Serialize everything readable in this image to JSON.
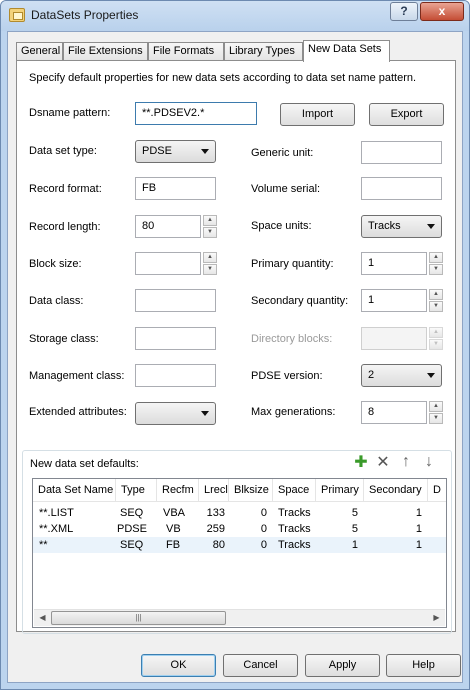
{
  "window": {
    "title": "DataSets Properties",
    "help_glyph": "?",
    "close_glyph": "x"
  },
  "tabs": [
    "General",
    "File Extensions",
    "File Formats",
    "Library Types",
    "New Data Sets"
  ],
  "active_tab": "New Data Sets",
  "description": "Specify default properties for new data sets according to data set name pattern.",
  "dsname": {
    "label": "Dsname pattern:",
    "value": "**.PDSEV2.*"
  },
  "buttons": {
    "import": "Import",
    "export": "Export"
  },
  "left_fields": {
    "data_set_type": {
      "label": "Data set type:",
      "value": "PDSE"
    },
    "record_format": {
      "label": "Record format:",
      "value": "FB"
    },
    "record_length": {
      "label": "Record length:",
      "value": "80"
    },
    "block_size": {
      "label": "Block size:",
      "value": ""
    },
    "data_class": {
      "label": "Data class:",
      "value": ""
    },
    "storage_class": {
      "label": "Storage class:",
      "value": ""
    },
    "management_class": {
      "label": "Management class:",
      "value": ""
    },
    "extended_attributes": {
      "label": "Extended attributes:",
      "value": ""
    }
  },
  "right_fields": {
    "generic_unit": {
      "label": "Generic unit:",
      "value": ""
    },
    "volume_serial": {
      "label": "Volume serial:",
      "value": ""
    },
    "space_units": {
      "label": "Space units:",
      "value": "Tracks"
    },
    "primary_quantity": {
      "label": "Primary quantity:",
      "value": "1"
    },
    "secondary_quantity": {
      "label": "Secondary quantity:",
      "value": "1"
    },
    "directory_blocks": {
      "label": "Directory blocks:",
      "value": ""
    },
    "pdse_version": {
      "label": "PDSE version:",
      "value": "2"
    },
    "max_generations": {
      "label": "Max generations:",
      "value": "8"
    }
  },
  "defaults": {
    "label": "New data set defaults:",
    "toolbar_icons": [
      "add-icon",
      "delete-icon",
      "move-up-icon",
      "move-down-icon"
    ],
    "columns": [
      "Data Set Name",
      "Type",
      "Recfm",
      "Lrecl",
      "Blksize",
      "Space",
      "Primary",
      "Secondary",
      "D"
    ],
    "rows": [
      [
        "**.LIST",
        "SEQ",
        "VBA",
        "133",
        "0",
        "Tracks",
        "5",
        "1"
      ],
      [
        "**.XML",
        "PDSE",
        "VB",
        "259",
        "0",
        "Tracks",
        "5",
        "1"
      ],
      [
        "**",
        "SEQ",
        "FB",
        "80",
        "0",
        "Tracks",
        "1",
        "1"
      ]
    ],
    "selected_row": 2
  },
  "footer": {
    "ok": "OK",
    "cancel": "Cancel",
    "apply": "Apply",
    "help": "Help"
  }
}
